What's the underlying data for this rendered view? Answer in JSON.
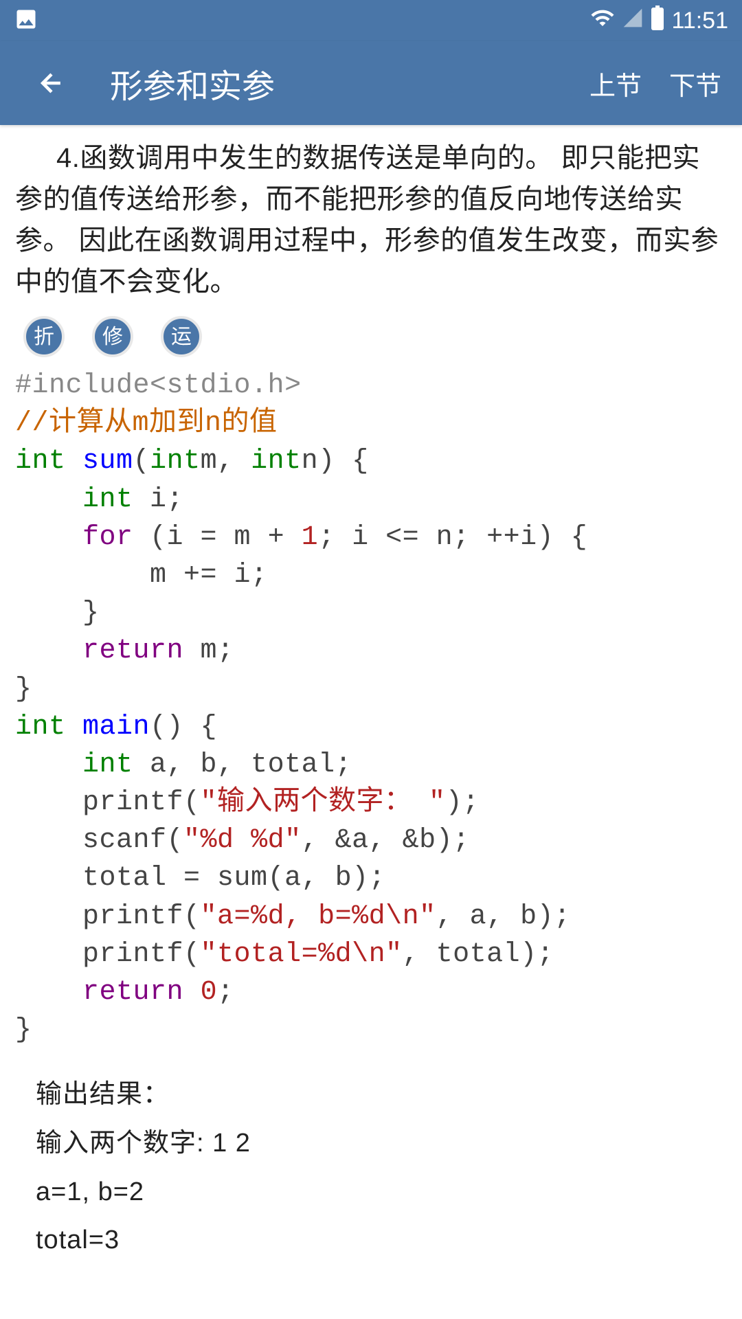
{
  "statusbar": {
    "time": "11:51"
  },
  "appbar": {
    "title": "形参和实参",
    "prev": "上节",
    "next": "下节"
  },
  "content": {
    "paragraph": "4.函数调用中发生的数据传送是单向的。 即只能把实参的值传送给形参，而不能把形参的值反向地传送给实参。 因此在函数调用过程中，形参的值发生改变，而实参中的值不会变化。",
    "btn_fold": "折",
    "btn_edit": "修",
    "btn_run": "运"
  },
  "code": {
    "l1": "#include<stdio.h>",
    "l2": "//计算从m加到n的值",
    "l3a": "int",
    "l3b": " ",
    "l3c": "sum",
    "l3d": "(",
    "l3e": "int",
    "l3f": "m, ",
    "l3g": "int",
    "l3h": "n) {",
    "l4a": "    ",
    "l4b": "int",
    "l4c": " i;",
    "l5a": "    ",
    "l5b": "for",
    "l5c": " (i = m + ",
    "l5d": "1",
    "l5e": "; i <= n; ++i) {",
    "l6": "        m += i;",
    "l7": "    }",
    "l8a": "    ",
    "l8b": "return",
    "l8c": " m;",
    "l9": "}",
    "l10a": "int",
    "l10b": " ",
    "l10c": "main",
    "l10d": "() {",
    "l11a": "    ",
    "l11b": "int",
    "l11c": " a, b, total;",
    "l12a": "    printf(",
    "l12b": "\"输入两个数字： \"",
    "l12c": ");",
    "l13a": "    scanf(",
    "l13b": "\"%d %d\"",
    "l13c": ", &a, &b);",
    "l14": "    total = sum(a, b);",
    "l15a": "    printf(",
    "l15b": "\"a=%d, b=%d\\n\"",
    "l15c": ", a, b);",
    "l16a": "    printf(",
    "l16b": "\"total=%d\\n\"",
    "l16c": ", total);",
    "l17a": "    ",
    "l17b": "return",
    "l17c": " ",
    "l17d": "0",
    "l17e": ";",
    "l18": "}"
  },
  "output": {
    "label": "输出结果：",
    "line1": "输入两个数字: 1 2",
    "line2": "a=1, b=2",
    "line3": "total=3"
  }
}
